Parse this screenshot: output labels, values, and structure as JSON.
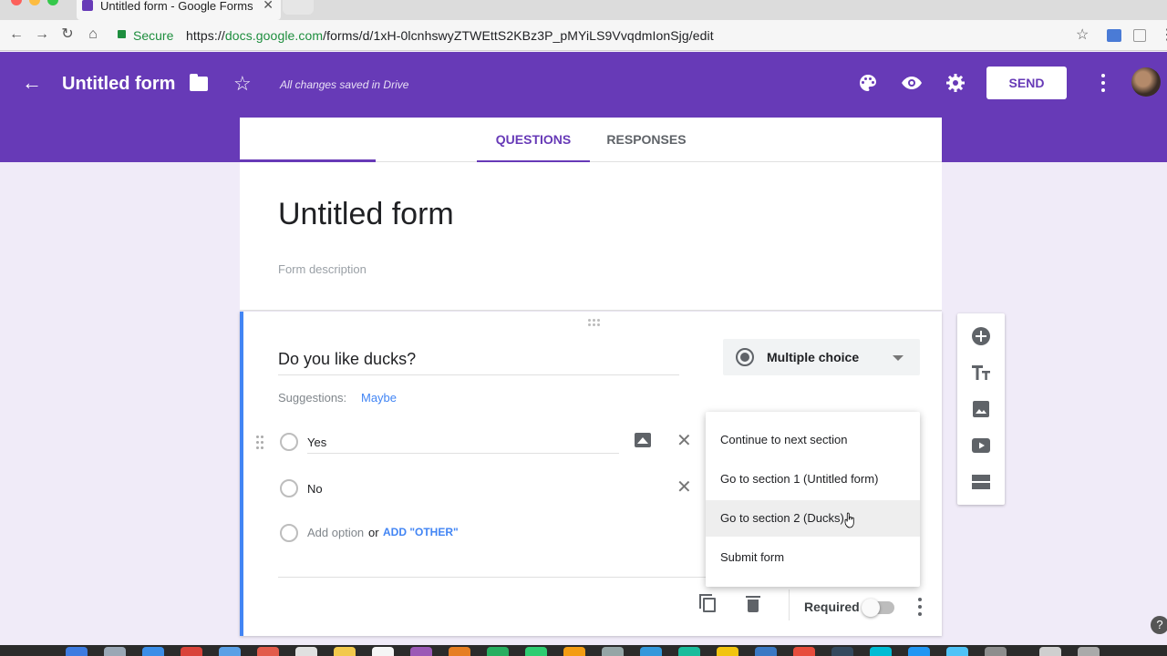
{
  "browser": {
    "tab_title": "Untitled form - Google Forms",
    "tab_close": "✕",
    "secure_label": "Secure",
    "url_scheme": "https://",
    "url_host": "docs.google.com",
    "url_path": "/forms/d/1xH-0lcnhswyZTWEttS2KBz3P_pMYiLS9VvqdmIonSjg/edit"
  },
  "header": {
    "form_title": "Untitled form",
    "saved_status": "All changes saved in Drive",
    "send_label": "SEND",
    "accent_color": "#673ab7"
  },
  "tabs": [
    {
      "label": "QUESTIONS",
      "active": true
    },
    {
      "label": "RESPONSES",
      "active": false
    }
  ],
  "form": {
    "title": "Untitled form",
    "description_placeholder": "Form description"
  },
  "question": {
    "title": "Do you like ducks?",
    "type_label": "Multiple choice",
    "suggestions_label": "Suggestions:",
    "suggestion_chip": "Maybe",
    "options": [
      {
        "label": "Yes"
      },
      {
        "label": "No"
      }
    ],
    "add_option": "Add option",
    "or_text": "or",
    "add_other": "ADD \"OTHER\"",
    "required_label": "Required",
    "required_on": false
  },
  "menu": {
    "items": [
      {
        "label": "Continue to next section"
      },
      {
        "label": "Go to section 1 (Untitled form)"
      },
      {
        "label": "Go to section 2 (Ducks)",
        "hovered": true
      },
      {
        "label": "Submit form"
      }
    ]
  },
  "side_toolbar": {
    "icons": [
      "add-question-icon",
      "add-title-icon",
      "add-image-icon",
      "add-video-icon",
      "add-section-icon"
    ]
  },
  "help": "?"
}
